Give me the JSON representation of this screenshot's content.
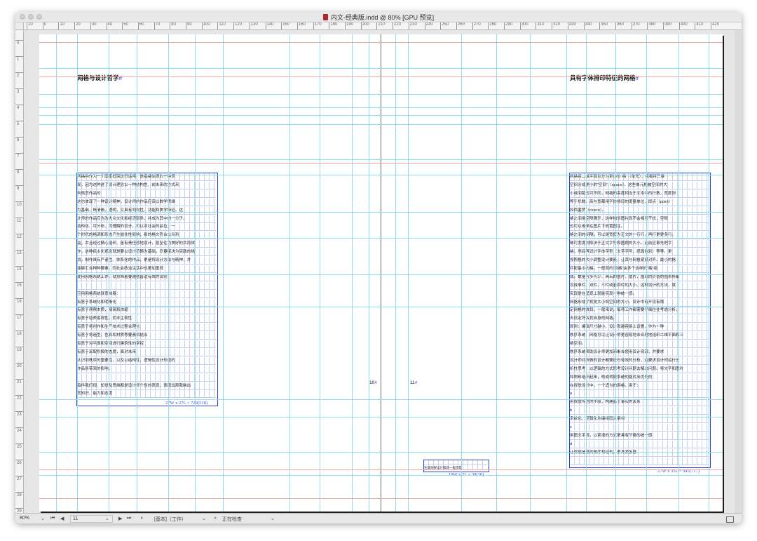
{
  "window": {
    "title": "内文-经典版.indd @ 80% [GPU 预览]"
  },
  "rulers": {
    "horizontal_ticks": [
      "10",
      "0",
      "10",
      "20",
      "30",
      "40",
      "50",
      "60",
      "70",
      "80",
      "90",
      "100",
      "110",
      "120",
      "130",
      "140",
      "150",
      "160",
      "170",
      "180",
      "190",
      "200",
      "210",
      "220",
      "230",
      "240",
      "250",
      "260",
      "270",
      "280",
      "290",
      "300",
      "310",
      "320",
      "330",
      "340",
      "350",
      "360",
      "370",
      "380",
      "390",
      "400",
      "410",
      "420"
    ],
    "vertical_ticks": [
      "0",
      "1",
      "2",
      "3",
      "4",
      "5",
      "6",
      "7",
      "8",
      "9",
      "10",
      "11",
      "12",
      "13",
      "14",
      "15",
      "16",
      "17",
      "18",
      "19",
      "20",
      "21",
      "22",
      "23",
      "24",
      "25",
      "26",
      "27",
      "28",
      "29"
    ]
  },
  "left_page": {
    "title": "网格与设计哲学",
    "lines": [
      "网格构作为一个固定框架进行运用，是指格体理的一种表",
      "现，因为这种进了设计理念以一种结构性、前未来的方式来",
      "构筑其作品的",
      "这也体现了一种设计精神，设计师的作品应该以数学思维",
      "为基础，既清晰、透明，又具有同构性、功能和美学特征。这",
      "计师的作品应当为大众文化和经济服务，并成为其中的一分子。",
      "结构化、可分析、可理解的设计，可以对社会的品位，一",
      "个时代的格调和形态产生催化性影响，新的格文符合公众利",
      "益，并且经过精心组织、富有责任感地设计，甚至往为美好的共同体",
      "作，这种民主化观念就是要以设计范畴为基础，尽量解决为实践的挑",
      "战，制作具有严谨性、体系化的作品，更是将设计方法与精神，并",
      "能够汇合种种要素，同社会政治生活中也更加重视",
      "使用网格系统工作，就意味着要遵循普适有效的法则",
      "",
      "应用网格系统就意味着：",
      "有意于系统化和明晰化",
      "有意于洞察本质，精简和浓缩",
      "有意于培养客观性，而非主观性",
      "有意于将创作和生产技术过程合理化",
      "有意于将造型、色彩和材质等要素相结合",
      "有意于对平面和空间进行建筑性的掌控",
      "有意于采取积极的态度，面对未来",
      "认识到秩序的重要性，以及以结构性、逻辑性设计形成的",
      "作品所带来的影响。",
      "",
      "每件我们视、知觉及思维都是设计师个性的表现，表现出那我映出",
      "其知识、能力和态度"
    ],
    "count": "27W x 27L = 729(518)"
  },
  "right_page": {
    "title": "具有字体排印特征的网格",
    "lines": [
      "网格将二维平面划分为更小的“格”（单元），或者将三维",
      "空间分成更小的“空间”（space）。这些单元格被空间的大",
      "小或间距也可不同，网格的高度相当于文本中的行数，宽度则",
      "等于栏数。高与宽都用字体排印的度量单位，即点（point）",
      "和西塞罗（cicero）。",
      "格之间用空隙隔开，这样相邻图片就不会相互干扰，空隙",
      "也可以用来在图片下放置图注。",
      "格之间的间隔，可以是宽度为正文的一行行，再行更更多行。",
      "稀可宽度则取决于正文字号和图题的大小。此前应事先把字",
      "格，然后再设计字体字型（文字字号，纸面色彩）等等。更",
      "按照格的大小调整设计要素，让其与网格紧紧对齐。最小的格",
      "匹配最小的格，一般而的“网格”由多个这样的“格”组",
      "成。数量可多可少。具有的图片，图片，图表的价值的图表将都",
      "设成单栏、双栏、三栏或者四栏的大小。这种设计的方法，就",
      "实现是在呈现上就能实现一种统一感。",
      "网格形成了视觉大小和空间的大小。设计中有开设有限",
      "定网格的数目，一般来说，每项工作都需要仔细往往考虑分析，",
      "去设定符合其自身的网格。",
      "原则：编辑尺寸越小，设计就越容易上设置，作为一种",
      "秩序系统，网格可以让设计师更容易地去合理地组织二维平面和三",
      "维空间。",
      "秩序系统帮助设计师更加清晰去使用设计资源，并要求",
      "设计师对所做的设计都要进行有效的分析，这要求设计师运行分",
      "析性思考，以逻辑的方式思考设计问题去解决问题。将文字和图片",
      "和物料组织起来，构成得更系统的格式出优先的",
      "在视觉设计中，一个适当的网格，用于：",
      "a",
      "用视觉传达的手段，构建基于事实的关系",
      "b",
      "系统化、逻辑化地编排图文素材",
      "c",
      "用图文手段，以紧凑的方式更具有节奏的统一感",
      "d",
      "让视觉信息的秩序和结构，更具紧张感",
      ""
    ],
    "count": "27W x 35L = 945(717)"
  },
  "spine": {
    "page_left": "10",
    "page_right": "11"
  },
  "small_frame": {
    "lines": [
      "",
      "生成效果设计稿的一般步骤"
    ],
    "count": "19W x 2L = 38(18)"
  },
  "status_bar": {
    "zoom": "80%",
    "page_field": "11",
    "master": "[基本]（工作）",
    "preflight": "正在检查"
  },
  "colors": {
    "guide_cyan": "#8ee0ee",
    "margin_red": "#f2a6a6",
    "selection_blue": "#2a46d8",
    "text_block": "#0000d8"
  }
}
